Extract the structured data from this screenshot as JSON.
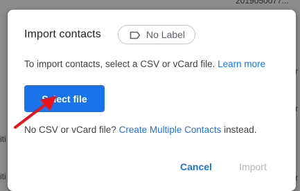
{
  "background": {
    "fragments": [
      "2019050077...",
      "iti",
      "iti",
      "r",
      "r",
      "r"
    ]
  },
  "dialog": {
    "title": "Import contacts",
    "label_chip": {
      "icon": "label-icon",
      "text": "No Label"
    },
    "description": {
      "text": "To import contacts, select a CSV or vCard file.",
      "link": "Learn more"
    },
    "select_file_button": "Select file",
    "alternative": {
      "prefix": "No CSV or vCard file?",
      "link": "Create Multiple Contacts",
      "suffix": "instead."
    },
    "actions": {
      "cancel": "Cancel",
      "import": "Import"
    }
  },
  "annotation": {
    "arrow_color": "#e8141c",
    "icon": "red-arrow-pointer"
  },
  "colors": {
    "accent": "#1a73e8",
    "disabled": "#b5b5b5",
    "backdrop": "#8c8c8c"
  }
}
